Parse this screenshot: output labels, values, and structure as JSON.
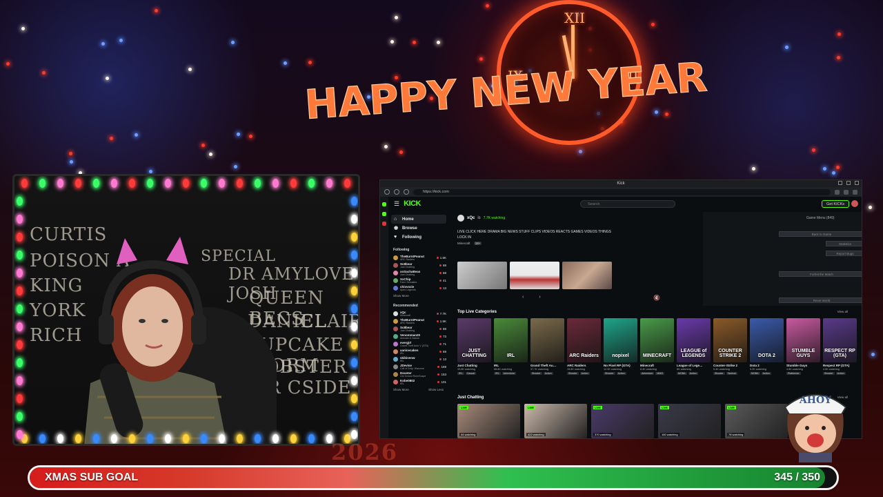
{
  "overlay": {
    "banner_text": "HAPPY NEW YEAR",
    "year_text": "2026",
    "subgoal": {
      "label": "XMAS SUB GOAL",
      "current": 345,
      "target": 350,
      "count_text": "345 / 350",
      "progress_fraction": 0.9857
    },
    "mascot_hat_text": "AHOY",
    "colors": {
      "accent_green": "#53fc18",
      "goal_red": "#d61c1c",
      "goal_green": "#1f9a3a"
    }
  },
  "webcam": {
    "board_words": [
      "CURTIS",
      "POISON A",
      "KING",
      "YORK",
      "RICH",
      "DR AMYLOVE JOSH",
      "QUEEN BECS",
      "DANIEL",
      "CLAIRE",
      "CUPCAKE STORM",
      "LOBSTER",
      "DR CSIDE",
      "SPECIAL"
    ]
  },
  "browser": {
    "window_title": "Kick",
    "url": "https://kick.com",
    "site": {
      "logo": "KICK",
      "search_placeholder": "Search",
      "get_kicks_label": "Get KICKs",
      "nav": [
        {
          "label": "Home",
          "icon": "home-icon",
          "active": true
        },
        {
          "label": "Browse",
          "icon": "compass-icon",
          "active": false
        },
        {
          "label": "Following",
          "icon": "heart-icon",
          "active": false
        }
      ],
      "following_title": "Following",
      "following": [
        {
          "name": "TheBurntPeanut",
          "sub": "ARC Raiders",
          "count": "1.5K",
          "color": "#c94"
        },
        {
          "name": "Sc8bear",
          "sub": "Just Chatting",
          "count": "88",
          "color": "#a55"
        },
        {
          "name": "xoSachaBeas",
          "sub": "Just Chatting",
          "count": "68",
          "color": "#d8a"
        },
        {
          "name": "XxChip",
          "sub": "Farm Simulator",
          "count": "41",
          "color": "#6a6"
        },
        {
          "name": "chivvozie",
          "sub": "Apex Legends",
          "count": "13",
          "color": "#67c"
        }
      ],
      "show_more_label": "Show More",
      "recommended_title": "Recommended",
      "recommended": [
        {
          "name": "xQc",
          "sub": "Minecraft",
          "count": "7.7K",
          "color": "#ddd"
        },
        {
          "name": "TheBurntPeanut",
          "sub": "ARC Raiders",
          "count": "1.5K",
          "color": "#c94"
        },
        {
          "name": "Sc8bear",
          "sub": "Just Chatting",
          "count": "88",
          "color": "#a55"
        },
        {
          "name": "Venomman20",
          "sub": "Animals & Nature",
          "count": "73",
          "color": "#5a8"
        },
        {
          "name": "evergirl",
          "sub": "Grand Theft Auto V (GTA)",
          "count": "71",
          "color": "#b7c"
        },
        {
          "name": "xanicecakes",
          "sub": "IRL",
          "count": "69",
          "color": "#c86"
        },
        {
          "name": "skibivenw",
          "sub": "IRL",
          "count": "13",
          "color": "#6ac"
        },
        {
          "name": "JDevise",
          "sub": "Call of Duty: Warzone",
          "count": "169",
          "color": "#888"
        },
        {
          "name": "Doxeter",
          "sub": "Old School RuneScape",
          "count": "153",
          "color": "#a84"
        },
        {
          "name": "Kobe0802",
          "sub": "IRL",
          "count": "101",
          "color": "#c66"
        }
      ],
      "show_more_label_2": "Show More",
      "show_less_label": "Show Less",
      "featured": {
        "streamer": "xQc",
        "status": "is",
        "viewers": "7.7K watching",
        "title": "LIVE CLICK HERE DRAMA BIG NEWS STUFF CLIPS VIDEOS REACTS GAMES VIDEOS THINGS LOCK IN",
        "category": "Minecraft",
        "badge": "18+"
      },
      "game_panel": {
        "title": "Game Menu (849)",
        "buttons": [
          "Back to Game",
          "Statistics",
          "Report Bugs",
          "Forfeit the Match",
          "Reset World"
        ]
      },
      "top_categories_title": "Top Live Categories",
      "view_all_label": "View all",
      "categories": [
        {
          "name": "Just Chatting",
          "art": "JUST CHATTING",
          "viewers": "33.8K watching",
          "tags": [
            "IRL",
            "Casual"
          ],
          "bg": "#5a3a6a"
        },
        {
          "name": "IRL",
          "art": "IRL",
          "viewers": "68.8K watching",
          "tags": [
            "IRL",
            "Adventure"
          ],
          "bg": "#4a8a3a"
        },
        {
          "name": "Grand Theft Au…",
          "art": "",
          "viewers": "37.7K watching",
          "tags": [
            "Shooter",
            "Action"
          ],
          "bg": "#7a6a4a"
        },
        {
          "name": "ARC Raiders",
          "art": "ARC Raiders",
          "viewers": "15.8K watching",
          "tags": [
            "Shooter",
            "Action"
          ],
          "bg": "#6a2a3a"
        },
        {
          "name": "No Pixel RP (GTA)",
          "art": "nopixel",
          "viewers": "12.9K watching",
          "tags": [
            "Shooter",
            "Action"
          ],
          "bg": "#1fa58a"
        },
        {
          "name": "Minecraft",
          "art": "MINECRAFT",
          "viewers": "8.4K watching",
          "tags": [
            "Adventure",
            "MMO"
          ],
          "bg": "#4a9a4a"
        },
        {
          "name": "League of Lege…",
          "art": "LEAGUE of LEGENDS",
          "viewers": "6K watching",
          "tags": [
            "MOBA",
            "Action"
          ],
          "bg": "#6a3aaa"
        },
        {
          "name": "Counter-Strike 2",
          "art": "COUNTER STRIKE 2",
          "viewers": "5.4K watching",
          "tags": [
            "Shooter",
            "Tactical"
          ],
          "bg": "#8a5a2a"
        },
        {
          "name": "Dota 2",
          "art": "DOTA 2",
          "viewers": "5.2K watching",
          "tags": [
            "MOBA",
            "Action"
          ],
          "bg": "#3a5aaa"
        },
        {
          "name": "Stumble Guys",
          "art": "STUMBLE GUYS",
          "viewers": "4.8K watching",
          "tags": [
            "Platformer"
          ],
          "bg": "#c85aa0"
        },
        {
          "name": "Respect RP (GTA)",
          "art": "RESPECT RP (GTA)",
          "viewers": "4.5K watching",
          "tags": [
            "Shooter",
            "Action"
          ],
          "bg": "#5a3a8a"
        }
      ],
      "just_chatting_title": "Just Chatting",
      "view_all_label_2": "View all",
      "live_label": "LIVE",
      "just_chatting_streams": [
        {
          "viewers": "44 watching",
          "bg": "#a88a7a"
        },
        {
          "viewers": "422 watching",
          "bg": "#cbb9aa"
        },
        {
          "viewers": "370 watching",
          "bg": "#4a3a6a"
        },
        {
          "viewers": "160 watching",
          "bg": "#3a3a4a"
        },
        {
          "viewers": "78 watching",
          "bg": "#5a5a5a"
        }
      ]
    }
  }
}
